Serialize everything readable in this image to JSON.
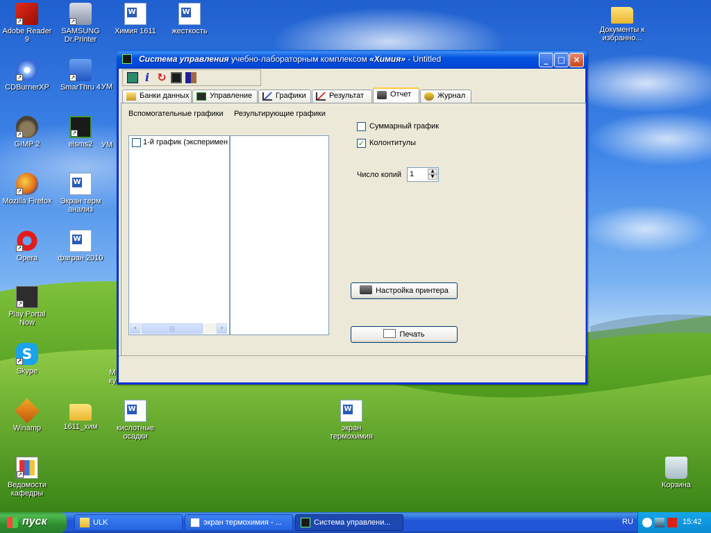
{
  "desktop": {
    "icons": {
      "adobe": "Adobe Reader 9",
      "samsung": "SAMSUNG Dr.Printer",
      "himiya1611": "Химия 1611",
      "zhestkost": "жесткость",
      "docs_fav": "Документы к избранно...",
      "cdburner": "CDBurnerXP",
      "smarthru": "SmarThru 4",
      "um": "УМ",
      "gimp": "GIMP 2",
      "elsms2": "elsms2",
      "um2": "УМ",
      "firefox": "Mozilla Firefox",
      "ekran_term": "Экран терм анализ",
      "opera": "Opera",
      "fagran": "фагран 2010",
      "playportal": "Play Portal Now",
      "skype": "Skype",
      "ku": "М ку",
      "winamp": "Winamp",
      "folder1611": "1611_хим",
      "kislotnye": "кислотные осадки",
      "ekran_termohimiya": "экран термохимия",
      "vedomosti": "Ведомости кафедры",
      "recycle": "Корзина"
    }
  },
  "window": {
    "title_italic": "Система управления",
    "title_rest": " учебно-лабораторным комплексом ",
    "title_brand": "«Химия»",
    "title_tail": " - Untitled",
    "tabs": {
      "banks": "Банки данных",
      "control": "Управление",
      "graphs": "Графики",
      "result": "Результат",
      "report": "Отчет",
      "journal": "Журнал"
    },
    "report": {
      "aux_graphs_label": "Вспомогательные графики",
      "result_graphs_label": "Результирующие графики",
      "aux_list_item": "1-й график (эксперимен",
      "summary_graph_label": "Суммарный график",
      "summary_graph_checked": false,
      "headers_label": "Колонтитулы",
      "headers_checked": true,
      "copies_label": "Число копий",
      "copies_value": "1",
      "printer_setup_button": "Настройка принтера",
      "print_button": "Печать"
    }
  },
  "taskbar": {
    "start_label": "пуск",
    "tasks": {
      "ulk": "ULK",
      "ekran": "экран термохимия - ...",
      "sistema": "Система управлени..."
    },
    "language": "RU",
    "clock": "15:42"
  }
}
